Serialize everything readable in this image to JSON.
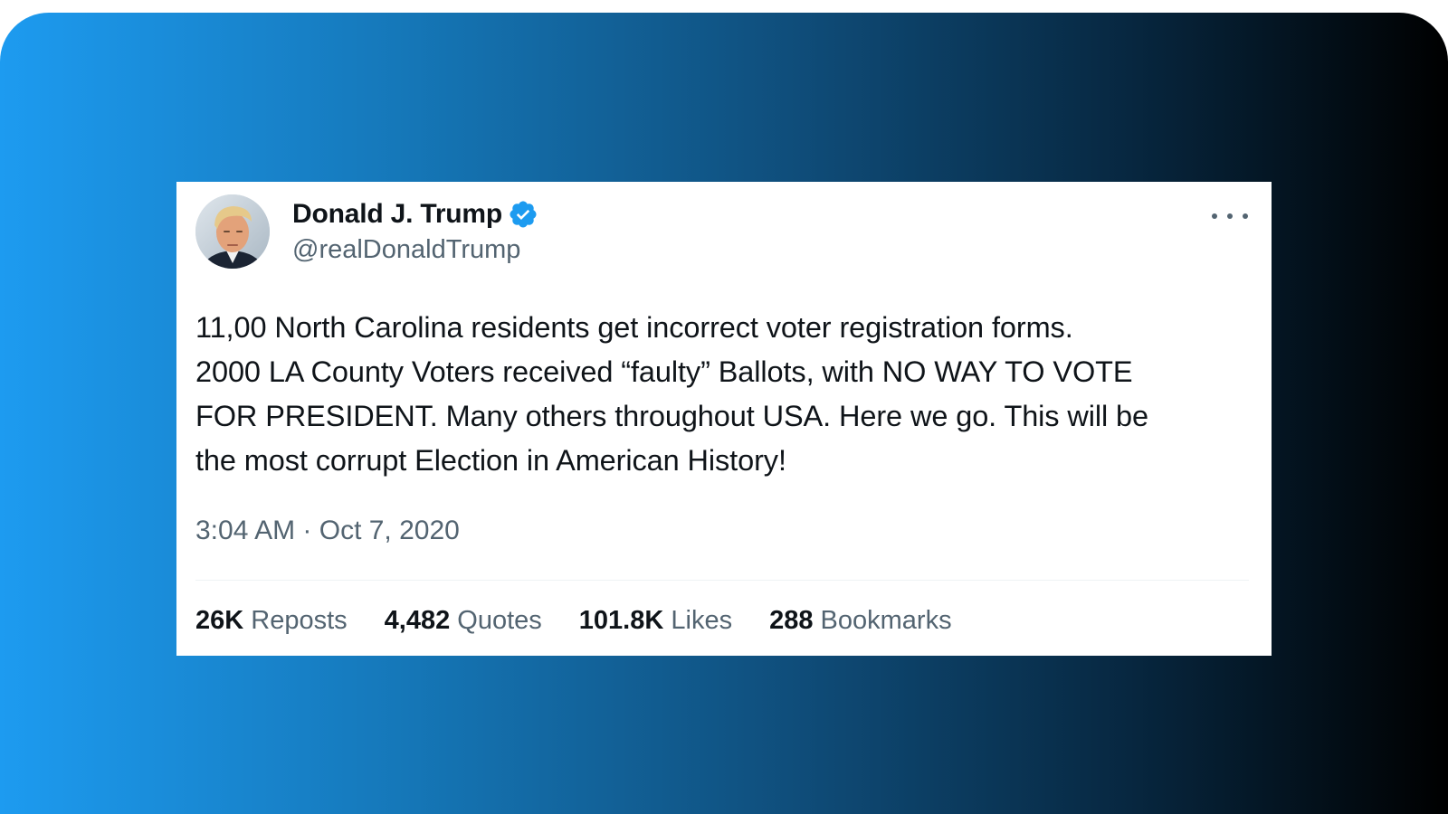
{
  "tweet": {
    "author": {
      "display_name": "Donald J. Trump",
      "handle": "@realDonaldTrump",
      "verified": true,
      "verified_color": "#1d9bf0"
    },
    "text_lines": [
      "11,00 North Carolina residents get incorrect voter registration forms.",
      "2000 LA County Voters received “faulty” Ballots, with NO WAY TO VOTE",
      "FOR PRESIDENT. Many others throughout USA. Here we go. This will be",
      "the most corrupt Election in American History!"
    ],
    "timestamp": "3:04 AM · Oct 7, 2020",
    "stats": [
      {
        "value": "26K",
        "label": "Reposts"
      },
      {
        "value": "4,482",
        "label": "Quotes"
      },
      {
        "value": "101.8K",
        "label": "Likes"
      },
      {
        "value": "288",
        "label": "Bookmarks"
      }
    ],
    "menu_icon": "more-horizontal-icon"
  },
  "theme": {
    "background_gradient": [
      "#1d9bf0",
      "#000000"
    ],
    "text_primary": "#0f1419",
    "text_secondary": "#536471"
  }
}
